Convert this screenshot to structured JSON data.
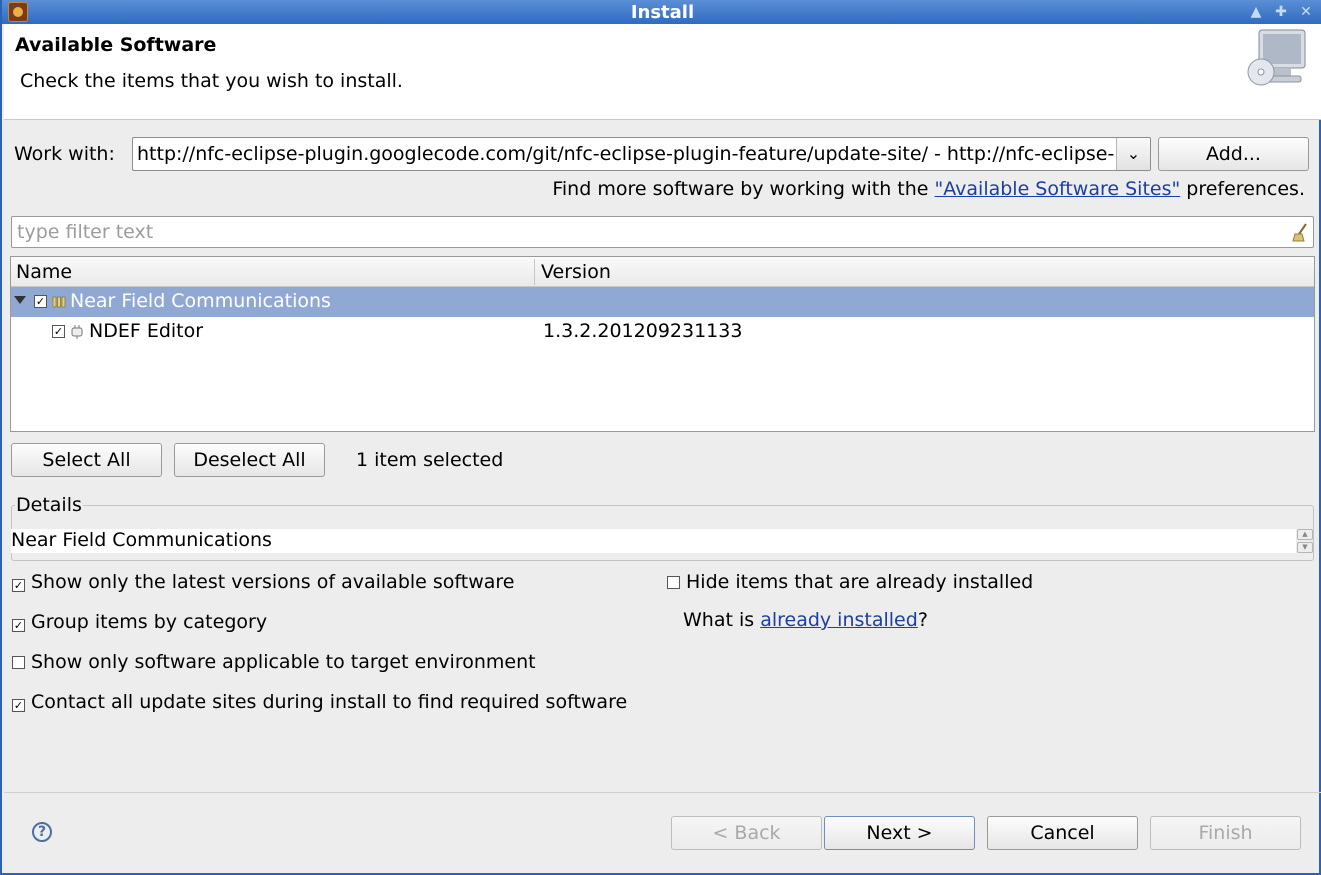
{
  "window": {
    "title": "Install"
  },
  "header": {
    "title": "Available Software",
    "subtitle": "Check the items that you wish to install."
  },
  "work_with": {
    "label": "Work with:",
    "value": "http://nfc-eclipse-plugin.googlecode.com/git/nfc-eclipse-plugin-feature/update-site/ - http://nfc-eclipse-plugin.googlecode.com/git/nfc-eclipse-plugin-feature/update-site/",
    "add_button": "Add..."
  },
  "more_software": {
    "prefix": "Find more software by working with the ",
    "link": "\"Available Software Sites\"",
    "suffix": " preferences."
  },
  "filter": {
    "placeholder": "type filter text"
  },
  "table": {
    "columns": [
      "Name",
      "Version"
    ],
    "rows": [
      {
        "name": "Near Field Communications",
        "version": "",
        "checked": true,
        "selected": true
      },
      {
        "name": "NDEF Editor",
        "version": "1.3.2.201209231133",
        "checked": true,
        "selected": false
      }
    ]
  },
  "selection": {
    "select_all": "Select All",
    "deselect_all": "Deselect All",
    "status": "1 item selected"
  },
  "details": {
    "label": "Details",
    "text": "Near Field Communications"
  },
  "options": {
    "latest_versions": "Show only the latest versions of available software",
    "group_by_category": "Group items by category",
    "applicable_only": "Show only software applicable to target environment",
    "contact_sites": "Contact all update sites during install to find required software",
    "hide_installed": "Hide items that are already installed",
    "what_is_prefix": "What is ",
    "already_installed_link": "already installed",
    "what_is_suffix": "?"
  },
  "footer": {
    "back": "< Back",
    "next": "Next >",
    "cancel": "Cancel",
    "finish": "Finish"
  }
}
